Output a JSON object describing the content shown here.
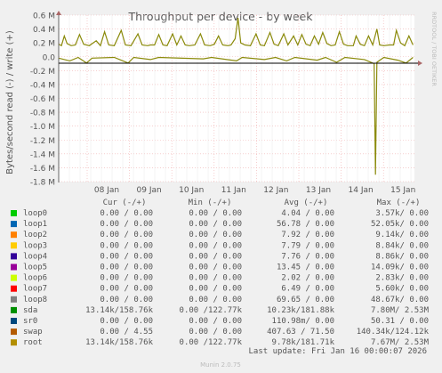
{
  "chart_data": {
    "type": "line",
    "title": "Throughput per device - by week",
    "ylabel": "Bytes/second read (-) / write (+)",
    "side_label": "RRDTOOL / TOBI OETIKER",
    "ylim": [
      -1800000,
      600000
    ],
    "y_ticks": [
      {
        "v": 600000,
        "label": "0.6 M"
      },
      {
        "v": 400000,
        "label": "0.4 M"
      },
      {
        "v": 200000,
        "label": "0.2 M"
      },
      {
        "v": 0,
        "label": "0.0"
      },
      {
        "v": -200000,
        "label": "-0.2 M"
      },
      {
        "v": -400000,
        "label": "-0.4 M"
      },
      {
        "v": -600000,
        "label": "-0.6 M"
      },
      {
        "v": -800000,
        "label": "-0.8 M"
      },
      {
        "v": -1000000,
        "label": "-1.0 M"
      },
      {
        "v": -1200000,
        "label": "-1.2 M"
      },
      {
        "v": -1400000,
        "label": "-1.4 M"
      },
      {
        "v": -1600000,
        "label": "-1.6 M"
      },
      {
        "v": -1800000,
        "label": "-1.8 M"
      }
    ],
    "x_ticks": [
      "08 Jan",
      "09 Jan",
      "10 Jan",
      "11 Jan",
      "12 Jan",
      "13 Jan",
      "14 Jan",
      "15 Jan"
    ],
    "grid": true,
    "series_write": {
      "name": "sda",
      "color": "#8a8a0a",
      "points": [
        [
          0.0,
          180000
        ],
        [
          0.01,
          160000
        ],
        [
          0.02,
          300000
        ],
        [
          0.03,
          190000
        ],
        [
          0.045,
          160000
        ],
        [
          0.06,
          170000
        ],
        [
          0.075,
          320000
        ],
        [
          0.09,
          180000
        ],
        [
          0.11,
          160000
        ],
        [
          0.135,
          230000
        ],
        [
          0.15,
          160000
        ],
        [
          0.165,
          360000
        ],
        [
          0.18,
          170000
        ],
        [
          0.2,
          160000
        ],
        [
          0.225,
          380000
        ],
        [
          0.24,
          170000
        ],
        [
          0.26,
          160000
        ],
        [
          0.285,
          330000
        ],
        [
          0.3,
          170000
        ],
        [
          0.32,
          160000
        ],
        [
          0.33,
          170000
        ],
        [
          0.345,
          170000
        ],
        [
          0.36,
          320000
        ],
        [
          0.375,
          170000
        ],
        [
          0.39,
          160000
        ],
        [
          0.41,
          330000
        ],
        [
          0.425,
          170000
        ],
        [
          0.44,
          300000
        ],
        [
          0.455,
          170000
        ],
        [
          0.47,
          160000
        ],
        [
          0.49,
          170000
        ],
        [
          0.51,
          330000
        ],
        [
          0.525,
          170000
        ],
        [
          0.545,
          160000
        ],
        [
          0.56,
          180000
        ],
        [
          0.575,
          300000
        ],
        [
          0.59,
          170000
        ],
        [
          0.61,
          160000
        ],
        [
          0.62,
          170000
        ],
        [
          0.635,
          260000
        ],
        [
          0.645,
          560000
        ],
        [
          0.655,
          200000
        ],
        [
          0.67,
          170000
        ],
        [
          0.69,
          160000
        ],
        [
          0.71,
          330000
        ],
        [
          0.725,
          170000
        ],
        [
          0.74,
          160000
        ],
        [
          0.76,
          350000
        ],
        [
          0.775,
          180000
        ],
        [
          0.79,
          160000
        ],
        [
          0.81,
          330000
        ],
        [
          0.825,
          170000
        ],
        [
          0.845,
          300000
        ],
        [
          0.86,
          170000
        ],
        [
          0.875,
          320000
        ],
        [
          0.89,
          180000
        ],
        [
          0.905,
          160000
        ],
        [
          0.92,
          300000
        ],
        [
          0.935,
          180000
        ],
        [
          0.95,
          350000
        ],
        [
          0.965,
          190000
        ],
        [
          0.98,
          160000
        ],
        [
          0.995,
          170000
        ],
        [
          1.01,
          360000
        ],
        [
          1.025,
          180000
        ],
        [
          1.04,
          160000
        ],
        [
          1.06,
          160000
        ],
        [
          1.07,
          300000
        ],
        [
          1.085,
          180000
        ],
        [
          1.1,
          160000
        ],
        [
          1.115,
          300000
        ],
        [
          1.13,
          170000
        ],
        [
          1.145,
          400000
        ],
        [
          1.155,
          170000
        ],
        [
          1.17,
          160000
        ],
        [
          1.19,
          170000
        ],
        [
          1.205,
          170000
        ],
        [
          1.215,
          380000
        ],
        [
          1.23,
          200000
        ],
        [
          1.245,
          160000
        ],
        [
          1.26,
          300000
        ],
        [
          1.275,
          170000
        ]
      ]
    },
    "series_read": {
      "name": "sda",
      "color": "#8a8a0a",
      "points": [
        [
          0.0,
          -20000
        ],
        [
          0.04,
          -60000
        ],
        [
          0.07,
          -10000
        ],
        [
          0.1,
          -90000
        ],
        [
          0.12,
          -20000
        ],
        [
          0.2,
          -10000
        ],
        [
          0.25,
          -90000
        ],
        [
          0.27,
          -10000
        ],
        [
          0.33,
          -40000
        ],
        [
          0.36,
          -10000
        ],
        [
          0.52,
          -30000
        ],
        [
          0.55,
          -10000
        ],
        [
          0.64,
          -60000
        ],
        [
          0.66,
          -10000
        ],
        [
          0.74,
          -40000
        ],
        [
          0.78,
          -10000
        ],
        [
          0.82,
          -60000
        ],
        [
          0.85,
          -10000
        ],
        [
          0.93,
          -50000
        ],
        [
          0.96,
          -10000
        ],
        [
          1.0,
          -80000
        ],
        [
          1.03,
          -10000
        ],
        [
          1.1,
          -40000
        ],
        [
          1.135,
          -100000
        ],
        [
          1.14,
          -1700000
        ],
        [
          1.145,
          -80000
        ],
        [
          1.17,
          -10000
        ],
        [
          1.22,
          -50000
        ],
        [
          1.25,
          -90000
        ],
        [
          1.275,
          -10000
        ]
      ]
    }
  },
  "legend": {
    "headers": {
      "cur": "Cur (-/+)",
      "min": "Min (-/+)",
      "avg": "Avg (-/+)",
      "max": "Max (-/+)"
    },
    "rows": [
      {
        "name": "loop0",
        "color": "#00cc00",
        "cur": "0.00 /  0.00",
        "min": "0.00 /  0.00",
        "avg": "4.04 /  0.00",
        "max": "3.57k/  0.00"
      },
      {
        "name": "loop1",
        "color": "#0066b3",
        "cur": "0.00 /  0.00",
        "min": "0.00 /  0.00",
        "avg": "56.78 /  0.00",
        "max": "52.05k/  0.00"
      },
      {
        "name": "loop2",
        "color": "#ff8000",
        "cur": "0.00 /  0.00",
        "min": "0.00 /  0.00",
        "avg": "7.92 /  0.00",
        "max": "9.14k/  0.00"
      },
      {
        "name": "loop3",
        "color": "#ffcc00",
        "cur": "0.00 /  0.00",
        "min": "0.00 /  0.00",
        "avg": "7.79 /  0.00",
        "max": "8.84k/  0.00"
      },
      {
        "name": "loop4",
        "color": "#330099",
        "cur": "0.00 /  0.00",
        "min": "0.00 /  0.00",
        "avg": "7.76 /  0.00",
        "max": "8.86k/  0.00"
      },
      {
        "name": "loop5",
        "color": "#990099",
        "cur": "0.00 /  0.00",
        "min": "0.00 /  0.00",
        "avg": "13.45 /  0.00",
        "max": "14.09k/  0.00"
      },
      {
        "name": "loop6",
        "color": "#ccff00",
        "cur": "0.00 /  0.00",
        "min": "0.00 /  0.00",
        "avg": "2.02 /  0.00",
        "max": "2.83k/  0.00"
      },
      {
        "name": "loop7",
        "color": "#ff0000",
        "cur": "0.00 /  0.00",
        "min": "0.00 /  0.00",
        "avg": "6.49 /  0.00",
        "max": "5.60k/  0.00"
      },
      {
        "name": "loop8",
        "color": "#808080",
        "cur": "0.00 /  0.00",
        "min": "0.00 /  0.00",
        "avg": "69.65 /  0.00",
        "max": "48.67k/  0.00"
      },
      {
        "name": "sda",
        "color": "#008f00",
        "cur": "13.14k/158.76k",
        "min": "0.00 /122.77k",
        "avg": "10.23k/181.88k",
        "max": "7.80M/  2.53M"
      },
      {
        "name": "sr0",
        "color": "#00487d",
        "cur": "0.00 /  0.00",
        "min": "0.00 /  0.00",
        "avg": "110.98m/  0.00",
        "max": "50.31 /  0.00"
      },
      {
        "name": "swap",
        "color": "#b35a00",
        "cur": "0.00 /  4.55",
        "min": "0.00 /  0.00",
        "avg": "407.63 / 71.50",
        "max": "140.34k/124.12k"
      },
      {
        "name": "root",
        "color": "#b38f00",
        "cur": "13.14k/158.76k",
        "min": "0.00 /122.77k",
        "avg": "9.78k/181.71k",
        "max": "7.67M/  2.53M"
      }
    ]
  },
  "last_update": "Last update: Fri Jan 16 00:00:07 2026",
  "footer": "Munin 2.0.75"
}
